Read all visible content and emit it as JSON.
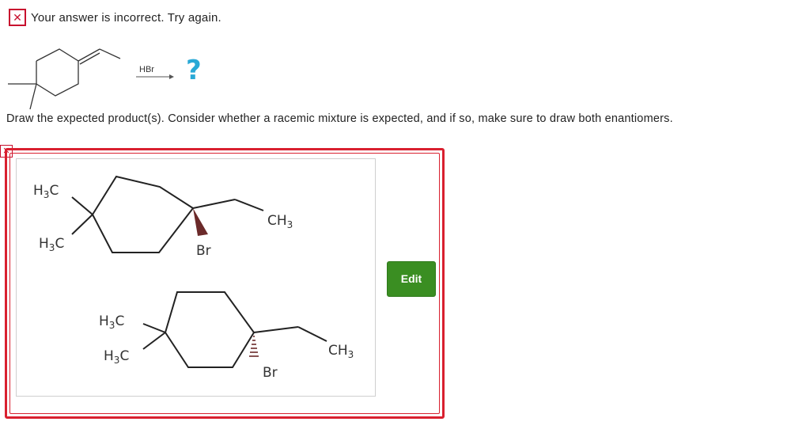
{
  "feedback": {
    "icon": "x-mark-icon",
    "message": "Your answer is incorrect.  Try again."
  },
  "reaction": {
    "reagent": "HBr",
    "unknown": "?"
  },
  "prompt": "Draw the expected product(s). Consider whether a racemic mixture is expected, and if so, make sure to draw both enantiomers.",
  "answer": {
    "status_icon": "x-mark-icon",
    "edit_label": "Edit",
    "structures": [
      {
        "methyl_1": "H",
        "methyl_1_sub": "3",
        "methyl_1_c": "C",
        "methyl_2": "H",
        "methyl_2_sub": "3",
        "methyl_2_c": "C",
        "ethyl_c": "CH",
        "ethyl_sub": "3",
        "halogen": "Br"
      },
      {
        "methyl_1": "H",
        "methyl_1_sub": "3",
        "methyl_1_c": "C",
        "methyl_2": "H",
        "methyl_2_sub": "3",
        "methyl_2_c": "C",
        "ethyl_c": "CH",
        "ethyl_sub": "3",
        "halogen": "Br"
      }
    ]
  },
  "colors": {
    "error_red": "#d9202f",
    "edit_green": "#3a8e22",
    "question_blue": "#29a9d6",
    "wedge": "#6b2a2a"
  }
}
